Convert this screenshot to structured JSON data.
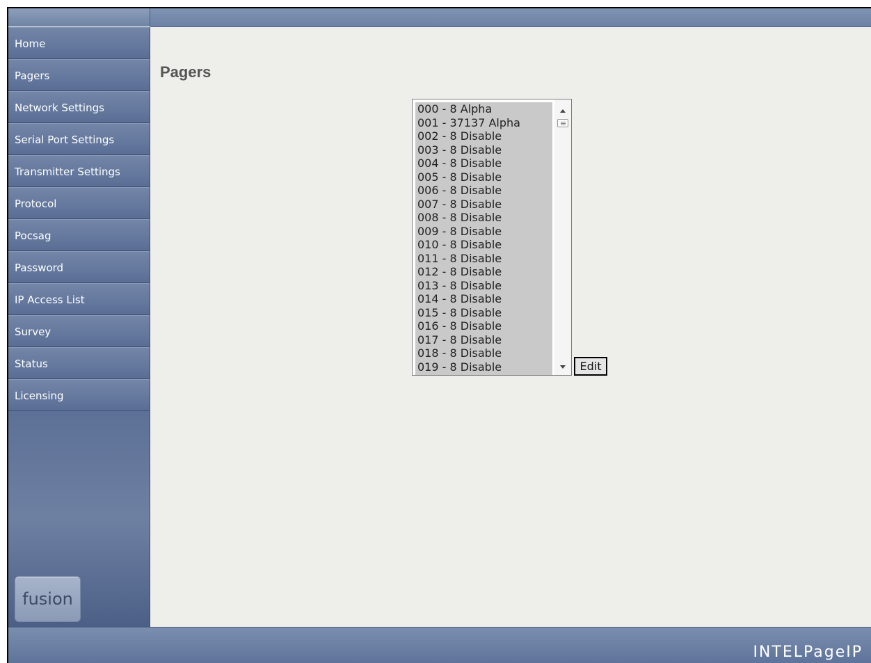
{
  "sidebar": {
    "items": [
      {
        "label": "Home"
      },
      {
        "label": "Pagers"
      },
      {
        "label": "Network Settings"
      },
      {
        "label": "Serial Port Settings"
      },
      {
        "label": "Transmitter Settings"
      },
      {
        "label": "Protocol"
      },
      {
        "label": "Pocsag"
      },
      {
        "label": "Password"
      },
      {
        "label": "IP Access List"
      },
      {
        "label": "Survey"
      },
      {
        "label": "Status"
      },
      {
        "label": "Licensing"
      }
    ],
    "logo_text": "fusion"
  },
  "main": {
    "title": "Pagers",
    "pager_list": [
      "000 - 8 Alpha",
      "001 - 37137 Alpha",
      "002 - 8 Disable",
      "003 - 8 Disable",
      "004 - 8 Disable",
      "005 - 8 Disable",
      "006 - 8 Disable",
      "007 - 8 Disable",
      "008 - 8 Disable",
      "009 - 8 Disable",
      "010 - 8 Disable",
      "011 - 8 Disable",
      "012 - 8 Disable",
      "013 - 8 Disable",
      "014 - 8 Disable",
      "015 - 8 Disable",
      "016 - 8 Disable",
      "017 - 8 Disable",
      "018 - 8 Disable",
      "019 - 8 Disable"
    ],
    "edit_label": "Edit"
  },
  "footer": {
    "brand": "INTELPageIP"
  }
}
